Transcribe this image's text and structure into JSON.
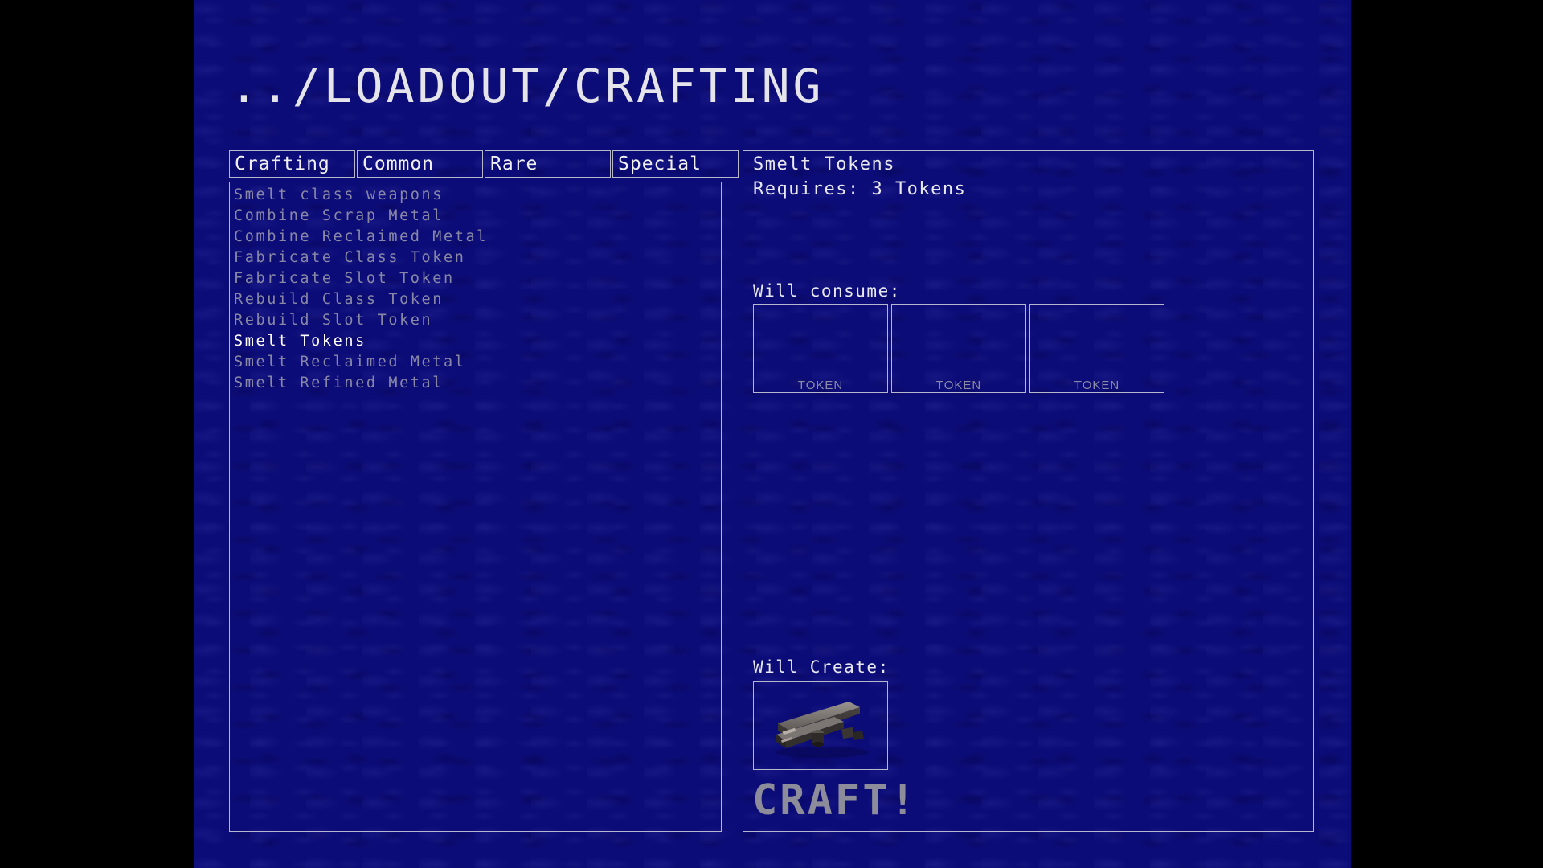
{
  "header": {
    "title": "../LOADOUT/CRAFTING"
  },
  "tabs": [
    {
      "label": "Crafting",
      "active": true
    },
    {
      "label": "Common",
      "active": false
    },
    {
      "label": "Rare",
      "active": false
    },
    {
      "label": "Special",
      "active": false
    }
  ],
  "recipes": [
    {
      "label": "Smelt class weapons",
      "selected": false
    },
    {
      "label": "Combine Scrap Metal",
      "selected": false
    },
    {
      "label": "Combine Reclaimed Metal",
      "selected": false
    },
    {
      "label": "Fabricate Class Token",
      "selected": false
    },
    {
      "label": "Fabricate Slot Token",
      "selected": false
    },
    {
      "label": "Rebuild Class Token",
      "selected": false
    },
    {
      "label": "Rebuild Slot Token",
      "selected": false
    },
    {
      "label": "Smelt Tokens",
      "selected": true
    },
    {
      "label": "Smelt Reclaimed Metal",
      "selected": false
    },
    {
      "label": "Smelt Refined Metal",
      "selected": false
    }
  ],
  "detail": {
    "name": "Smelt Tokens",
    "requires": "Requires: 3 Tokens",
    "consume_label": "Will consume:",
    "consume_slots": [
      {
        "label": "TOKEN"
      },
      {
        "label": "TOKEN"
      },
      {
        "label": "TOKEN"
      }
    ],
    "create_label": "Will Create:",
    "create_item_icon": "scrap-metal-icon",
    "craft_label": "CRAFT!"
  },
  "colors": {
    "background": "#0c0c78",
    "border": "#b8b8cc",
    "text_bright": "#ffffff",
    "text_dim": "#8888a6",
    "craft_disabled": "#8c8c9a"
  }
}
